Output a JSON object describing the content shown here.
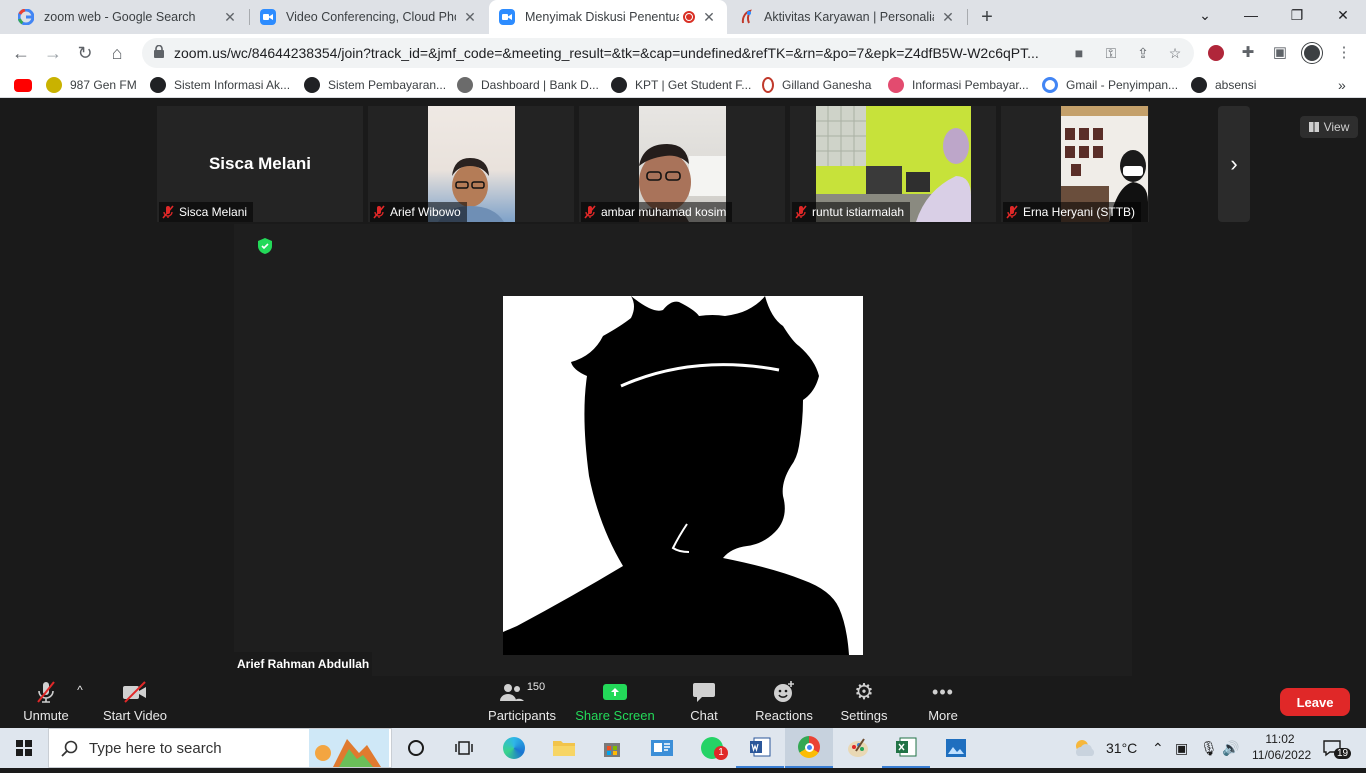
{
  "browser": {
    "tabs": [
      {
        "title": "zoom web - Google Search",
        "icon": "google-icon"
      },
      {
        "title": "Video Conferencing, Cloud Phone",
        "icon": "zoom-icon"
      },
      {
        "title": "Menyimak Diskusi Penentuan",
        "icon": "zoom-icon",
        "active": true
      },
      {
        "title": "Aktivitas Karyawan | Personalia G",
        "icon": "personalia-icon"
      }
    ],
    "url": "zoom.us/wc/84644238354/join?track_id=&jmf_code=&meeting_result=&tk=&cap=undefined&refTK=&rn=&po=7&epk=Z4dfB5W-W2c6qPT...",
    "bookmarks": [
      {
        "label": "",
        "icon": "youtube-icon"
      },
      {
        "label": "987 Gen FM",
        "icon": "genfm-icon"
      },
      {
        "label": "Sistem Informasi Ak...",
        "icon": "web-icon"
      },
      {
        "label": "Sistem Pembayaran...",
        "icon": "web-icon"
      },
      {
        "label": "Dashboard | Bank D...",
        "icon": "bank-icon"
      },
      {
        "label": "KPT | Get Student F...",
        "icon": "web-icon"
      },
      {
        "label": "Gilland Ganesha",
        "icon": "gilland-icon"
      },
      {
        "label": "Informasi Pembayar...",
        "icon": "info-icon"
      },
      {
        "label": "Gmail - Penyimpan...",
        "icon": "google-icon"
      },
      {
        "label": "absensi",
        "icon": "web-icon"
      }
    ],
    "more_bookmarks": "»"
  },
  "zoom": {
    "participants_strip": [
      {
        "name": "Sisca Melani",
        "video": false,
        "display_name": "Sisca Melani"
      },
      {
        "name": "Arief Wibowo",
        "video": true
      },
      {
        "name": "ambar muhamad kosim",
        "video": true
      },
      {
        "name": "runtut istiarmalah",
        "video": true
      },
      {
        "name": "Erna Heryani (STTB)",
        "video": true
      }
    ],
    "view_label": "View",
    "speaker_name": "Arief Rahman Abdullah",
    "controls": {
      "unmute": "Unmute",
      "start_video": "Start Video",
      "participants": "Participants",
      "participants_count": "150",
      "share_screen": "Share Screen",
      "chat": "Chat",
      "reactions": "Reactions",
      "settings": "Settings",
      "more": "More",
      "leave": "Leave"
    },
    "colors": {
      "share_green": "#23d959",
      "leave_red": "#e02828",
      "mute_red": "#e02828"
    }
  },
  "taskbar": {
    "search_placeholder": "Type here to search",
    "weather_temp": "31°C",
    "time": "11:02",
    "date": "11/06/2022",
    "notifications": "19",
    "whatsapp_badge": "1"
  }
}
